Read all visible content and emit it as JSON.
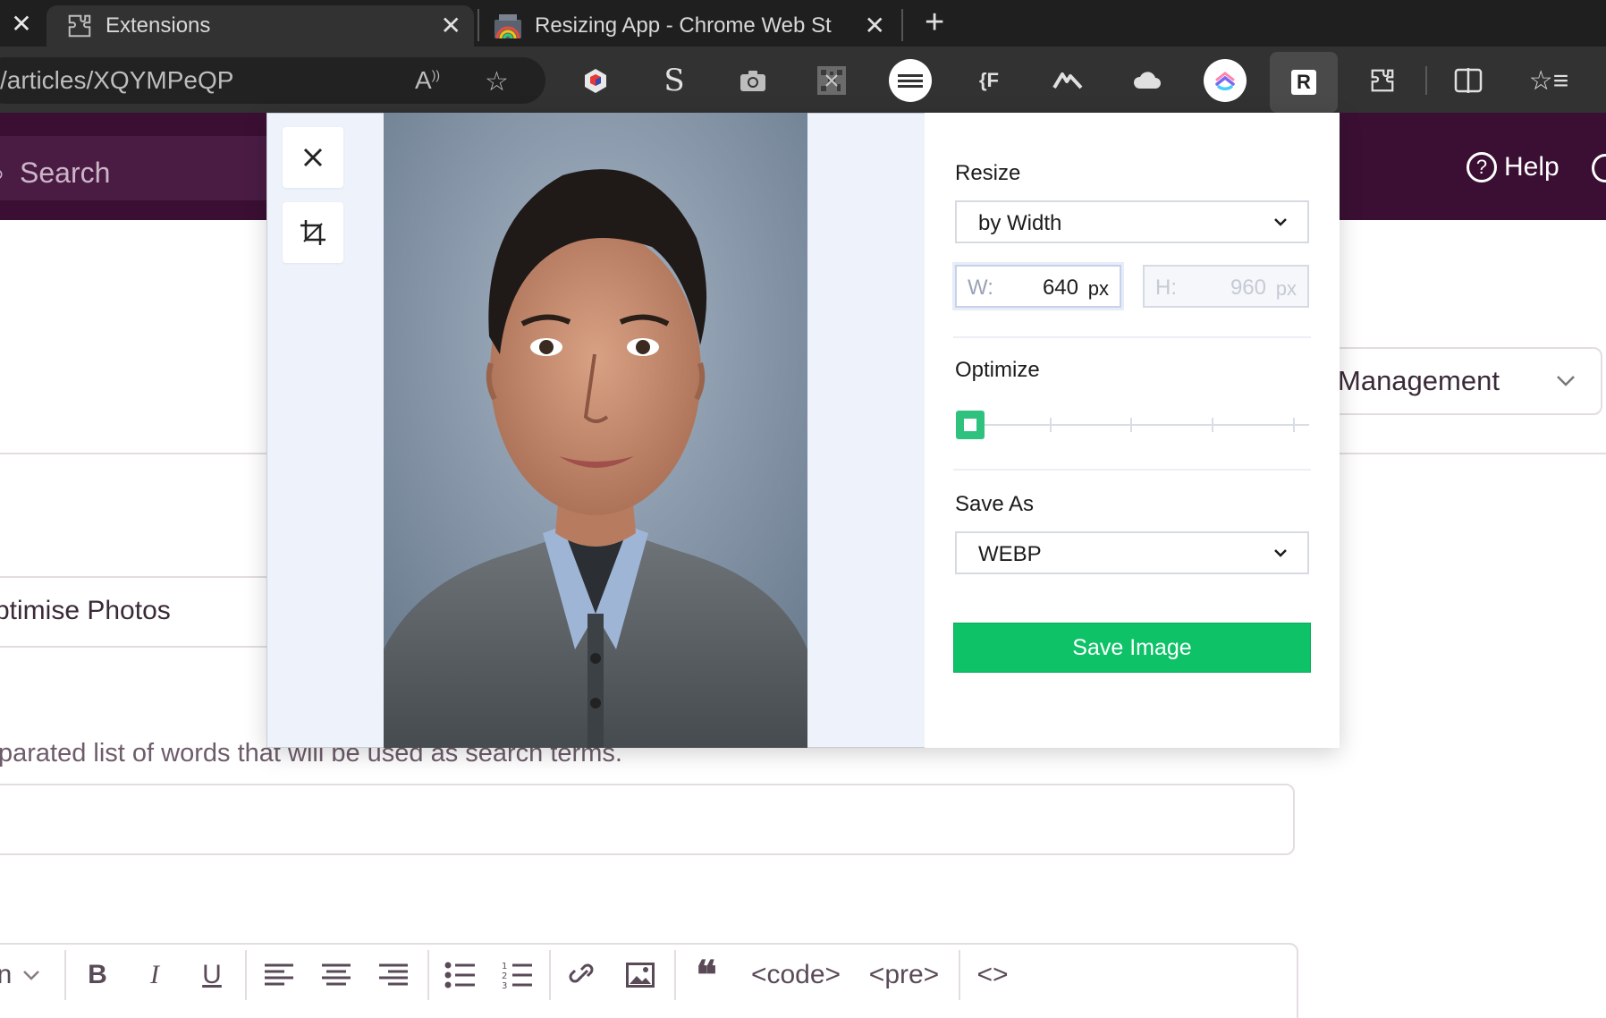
{
  "browser": {
    "tabs": [
      {
        "label": "Extensions"
      },
      {
        "label": "Resizing App - Chrome Web St"
      }
    ],
    "url": "/articles/XQYMPeQP",
    "icons": [
      "read-aloud-icon",
      "favorite-star-icon",
      "cube-extension-icon",
      "s-extension-icon",
      "camera-extension-icon",
      "qr-extension-icon",
      "keyboard-extension-icon",
      "json-extension-icon",
      "mountain-extension-icon",
      "cloud-extension-icon",
      "clickup-extension-icon",
      "resize-extension-icon",
      "extensions-puzzle-icon",
      "split-screen-icon",
      "favorites-list-icon"
    ],
    "json_icon_text": "{F",
    "resize_icon_text": "R"
  },
  "page": {
    "search_placeholder": "Search",
    "help_label": "Help",
    "management_select": "Management",
    "section_title": "ptimise Photos",
    "hint_text": "parated list of words that will be used as search terms.",
    "editor_toolbar": {
      "block_format": "n",
      "bold": "B",
      "italic": "I",
      "underline": "U",
      "quote": "❝",
      "code": "<code>",
      "pre": "<pre>",
      "source": "<>"
    }
  },
  "modal": {
    "resize_label": "Resize",
    "resize_mode": "by Width",
    "width_label": "W:",
    "width_value": "640",
    "height_label": "H:",
    "height_value": "960",
    "unit": "px",
    "optimize_label": "Optimize",
    "optimize_level": 0,
    "optimize_steps": 5,
    "save_as_label": "Save As",
    "save_format": "WEBP",
    "save_button": "Save Image"
  },
  "colors": {
    "accent_green": "#0ec268",
    "slider_green": "#2ec27e",
    "header_purple": "#3a0f33"
  }
}
